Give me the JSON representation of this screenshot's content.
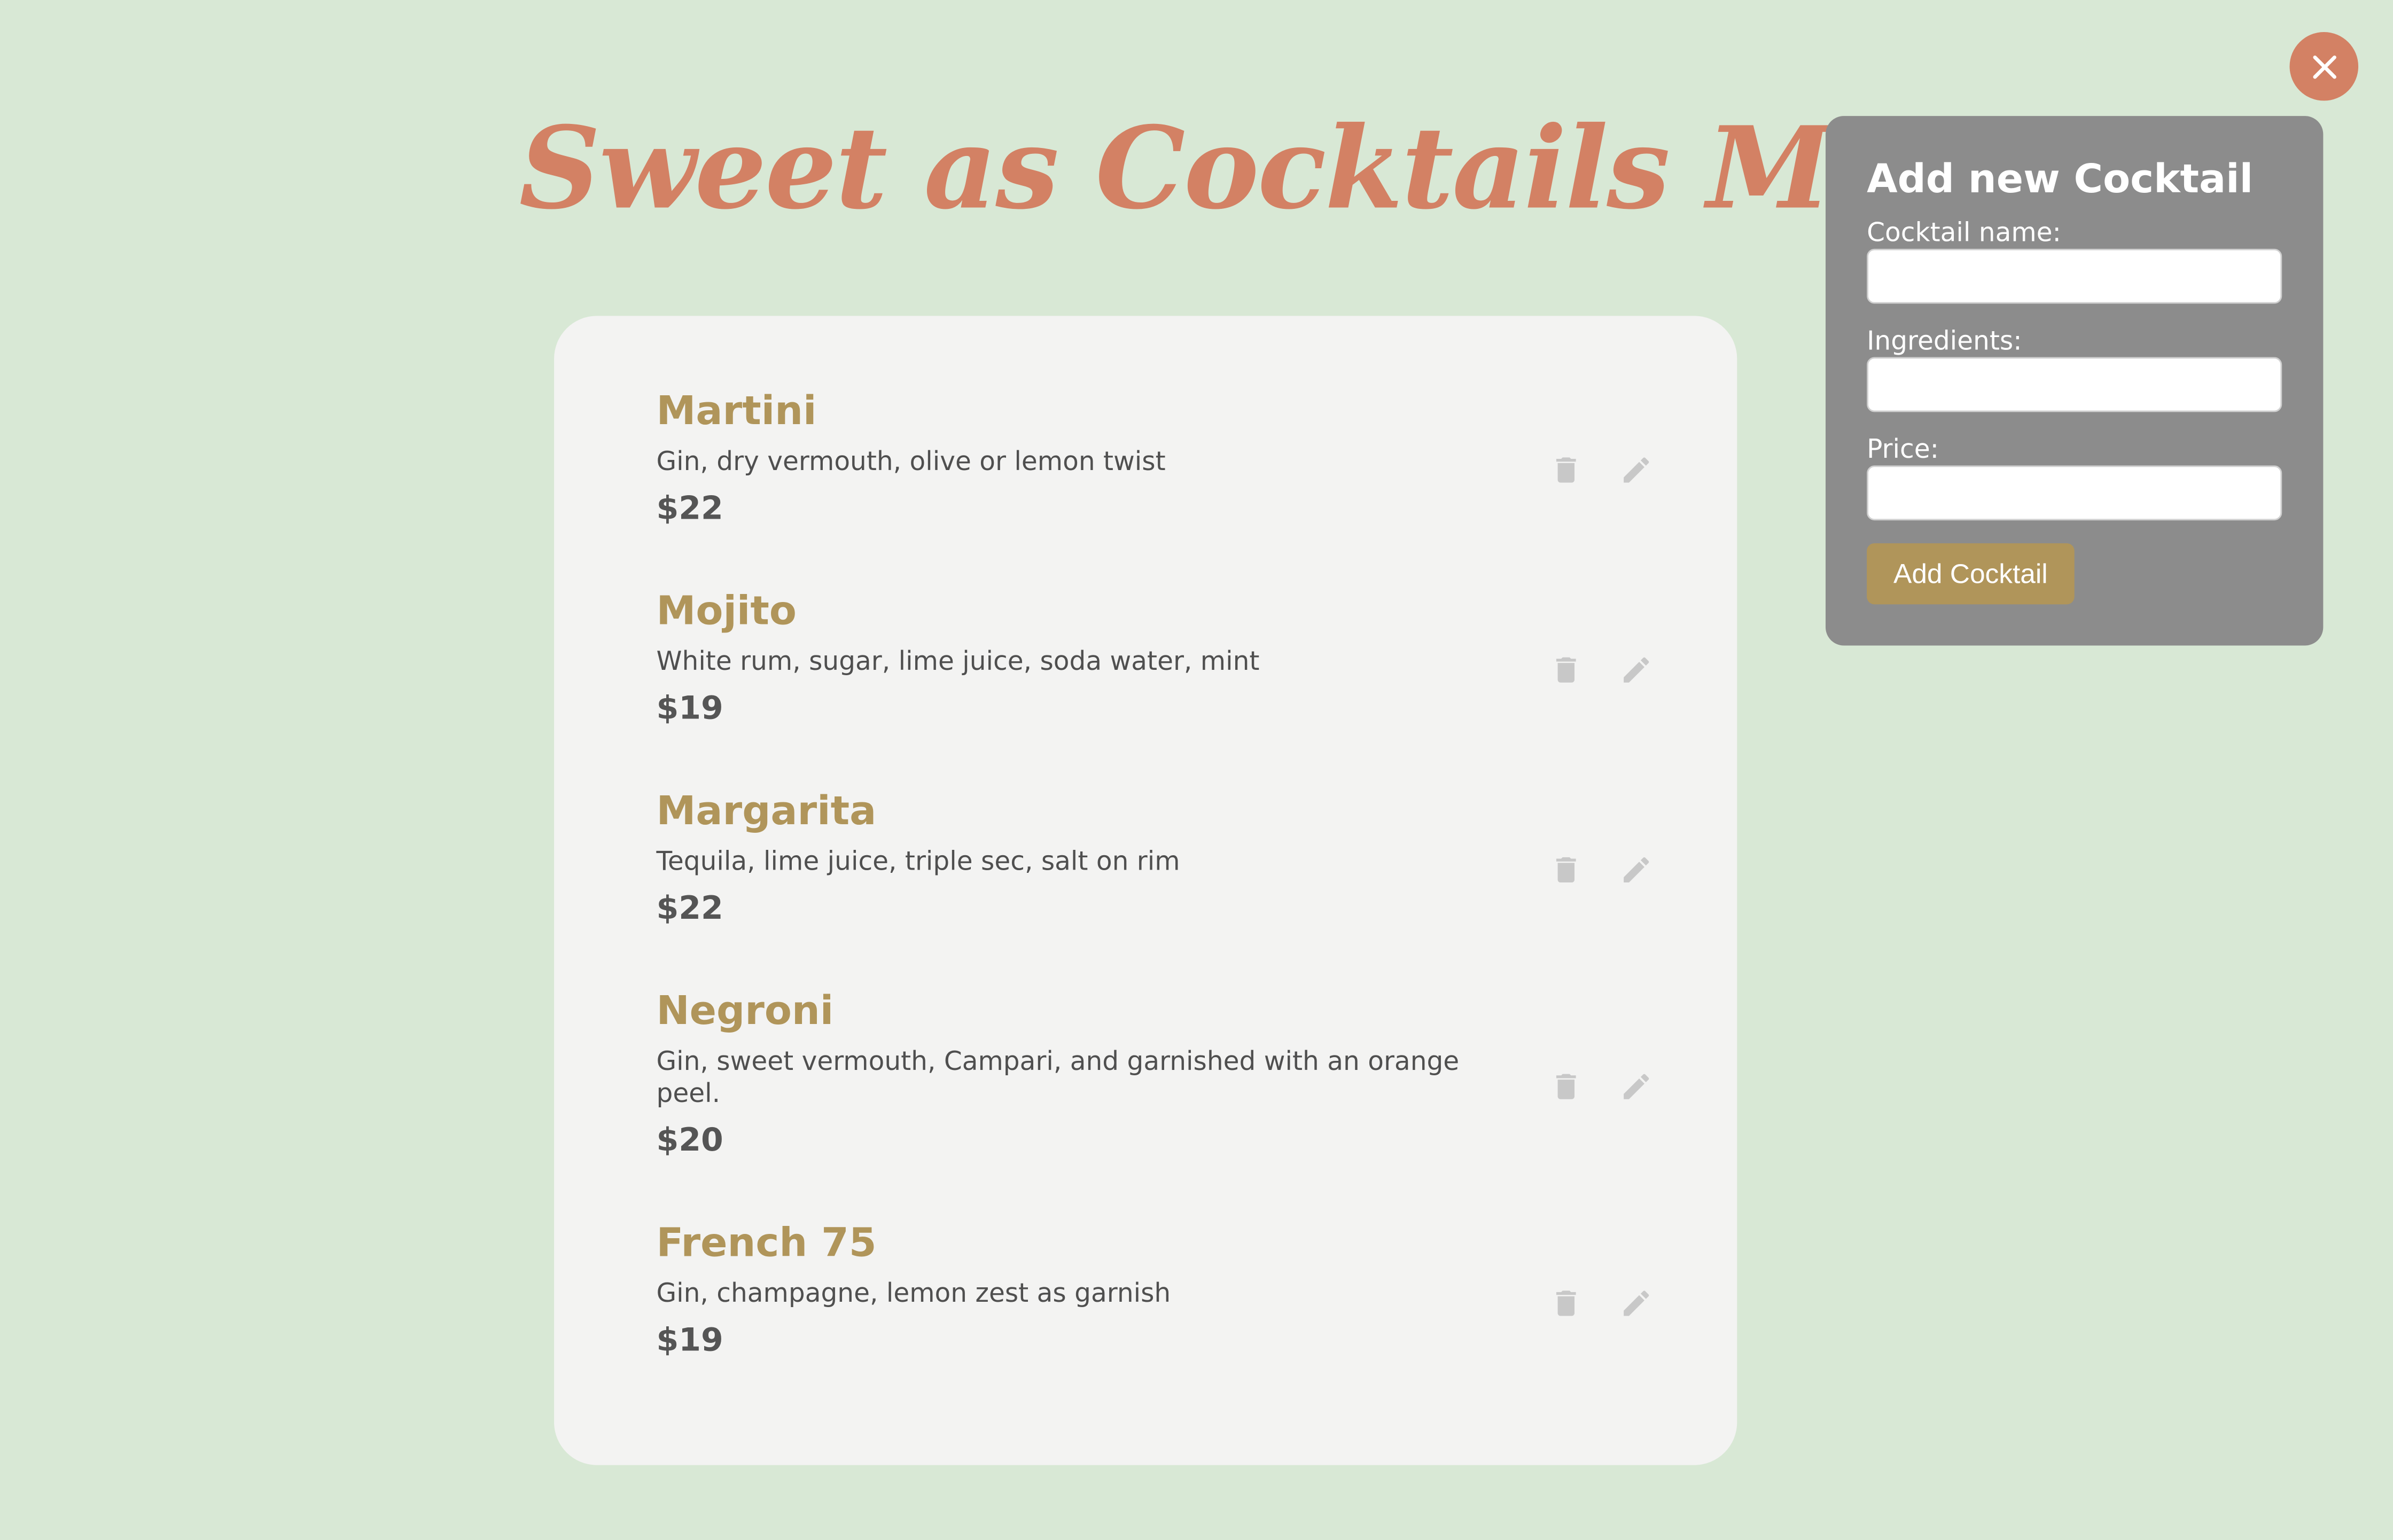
{
  "page": {
    "title": "Sweet as Cocktails Menu"
  },
  "colors": {
    "background": "#d8e8d5",
    "accent": "#d38164",
    "gold": "#b0955a",
    "card": "#f3f3f2",
    "panel": "#8c8c8c",
    "icon": "#c8c8c8"
  },
  "icons": {
    "close": "close-icon",
    "delete": "trash-icon",
    "edit": "pencil-icon"
  },
  "menu": {
    "items": [
      {
        "name": "Martini",
        "ingredients": "Gin, dry vermouth, olive or lemon twist",
        "price": "$22"
      },
      {
        "name": "Mojito",
        "ingredients": "White rum, sugar, lime juice, soda water, mint",
        "price": "$19"
      },
      {
        "name": "Margarita",
        "ingredients": "Tequila, lime juice, triple sec, salt on rim",
        "price": "$22"
      },
      {
        "name": "Negroni",
        "ingredients": "Gin, sweet vermouth, Campari, and garnished with an orange peel.",
        "price": "$20"
      },
      {
        "name": "French 75",
        "ingredients": "Gin, champagne, lemon zest as garnish",
        "price": "$19"
      }
    ]
  },
  "form": {
    "title": "Add new Cocktail",
    "name_label": "Cocktail name:",
    "name_value": "",
    "ingredients_label": "Ingredients:",
    "ingredients_value": "",
    "price_label": "Price:",
    "price_value": "",
    "submit_label": "Add Cocktail"
  }
}
